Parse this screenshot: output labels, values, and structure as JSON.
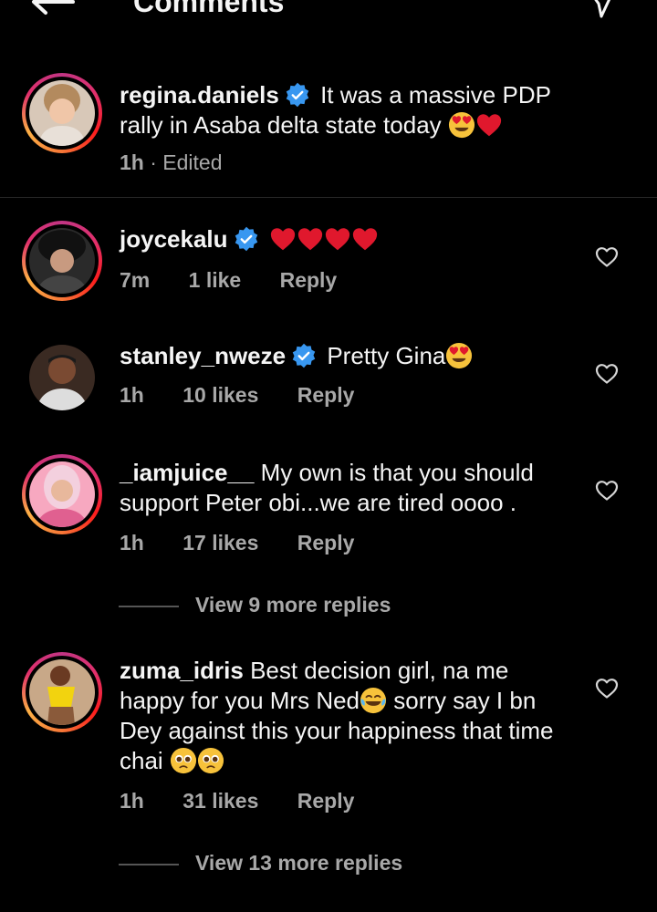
{
  "header": {
    "title": "Comments",
    "back_icon": "arrow-left-icon",
    "send_icon": "send-icon"
  },
  "colors": {
    "background": "#000000",
    "text": "#f5f5f5",
    "muted": "#a8a8a8",
    "verified": "#3897f0",
    "heart_red": "#e0182d"
  },
  "caption": {
    "username": "regina.daniels",
    "text": "It was a massive PDP rally in Asaba delta state today",
    "emojis": [
      "heart-eyes-emoji",
      "red-heart-emoji"
    ],
    "time": "1h",
    "edited": "· Edited"
  },
  "comments": [
    {
      "username": "joycekalu",
      "verified": true,
      "text": "",
      "emojis": [
        "red-heart-emoji",
        "red-heart-emoji",
        "red-heart-emoji",
        "red-heart-emoji"
      ],
      "time": "7m",
      "likes": "1 like",
      "reply": "Reply"
    },
    {
      "username": "stanley_nweze",
      "verified": true,
      "text": "Pretty Gina",
      "emojis": [
        "heart-eyes-emoji"
      ],
      "time": "1h",
      "likes": "10 likes",
      "reply": "Reply"
    },
    {
      "username": "_iamjuice__",
      "verified": false,
      "text": "My own is that you should support Peter obi...we are tired oooo .",
      "time": "1h",
      "likes": "17 likes",
      "reply": "Reply",
      "view_replies": "View 9 more replies"
    },
    {
      "username": "zuma_idris",
      "verified": false,
      "text_parts": [
        "Best decision girl, na me happy for you Mrs Ned",
        "sorry say I bn Dey against this your happiness that time chai"
      ],
      "emojis": [
        "joy-emoji",
        "pleading-emoji",
        "pleading-emoji"
      ],
      "time": "1h",
      "likes": "31 likes",
      "reply": "Reply",
      "view_replies": "View 13 more replies"
    }
  ]
}
